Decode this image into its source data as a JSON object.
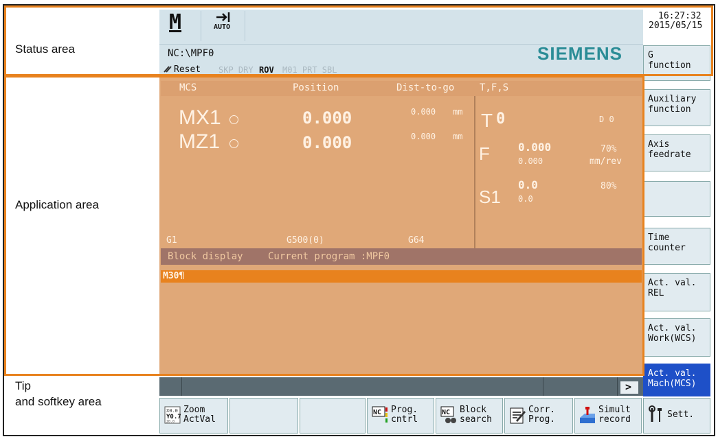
{
  "labels": {
    "status_area": "Status area",
    "application_area": "Application area",
    "tip_line1": "Tip",
    "tip_line2": "and softkey area"
  },
  "status": {
    "mode_icon": "M",
    "auto_label": "AUTO",
    "program_path": "NC:\\MPF0",
    "reset_label": "Reset",
    "prog_flags_dim": "SKP DRY",
    "prog_flag_active": "ROV",
    "prog_flags_dim2": "M01 PRT SBL",
    "brand": "SIEMENS",
    "time": "16:27:32",
    "date": "2015/05/15"
  },
  "table": {
    "headers": {
      "mcs": "MCS",
      "position": "Position",
      "dist": "Dist-to-go",
      "tfs": "T,F,S"
    },
    "axes": [
      {
        "name": "MX1",
        "position": "0.000",
        "dist": "0.000",
        "unit": "mm"
      },
      {
        "name": "MZ1",
        "position": "0.000",
        "dist": "0.000",
        "unit": "mm"
      }
    ],
    "tool": {
      "label": "T",
      "value": "0",
      "d_label": "D 0"
    },
    "feed": {
      "label": "F",
      "value": "0.000",
      "value2": "0.000",
      "override": "70%",
      "unit": "mm/rev"
    },
    "spindle": {
      "label": "S1",
      "value": "0.0",
      "value2": "0.0",
      "override": "80%"
    },
    "g_codes": [
      "G1",
      "G500(0)",
      "G64"
    ]
  },
  "block": {
    "title": "Block display",
    "program": "Current program :MPF0",
    "line": "M30¶"
  },
  "softkeys_right": [
    {
      "line1": "G",
      "line2": "function"
    },
    {
      "line1": "Auxiliary",
      "line2": "function"
    },
    {
      "line1": "Axis",
      "line2": "feedrate"
    },
    {
      "line1": "",
      "line2": ""
    },
    {
      "line1": "Time",
      "line2": "counter"
    },
    {
      "line1": "Act. val.",
      "line2": "REL"
    },
    {
      "line1": "Act. val.",
      "line2": "Work(WCS)"
    },
    {
      "line1": "Act. val.",
      "line2": "Mach(MCS)"
    }
  ],
  "softkeys_bottom": [
    {
      "line1": "Zoom",
      "line2": "ActVal"
    },
    {
      "line1": "",
      "line2": ""
    },
    {
      "line1": "",
      "line2": ""
    },
    {
      "line1": "Prog.",
      "line2": "cntrl"
    },
    {
      "line1": "Block",
      "line2": "search"
    },
    {
      "line1": "Corr.",
      "line2": "Prog."
    },
    {
      "line1": "Simult",
      "line2": "record"
    },
    {
      "line1": "Sett.",
      "line2": ""
    }
  ],
  "tip": {
    "arrow": ">"
  },
  "colors": {
    "status_bg": "#d4e3ea",
    "app_bg": "#e0a878",
    "block_header_bg": "#a07468",
    "block_line_bg": "#e8821e",
    "softkey_bg": "#e1ebf0",
    "softkey_active_bg": "#1e50c8",
    "annotation_orange": "#e8821e"
  }
}
